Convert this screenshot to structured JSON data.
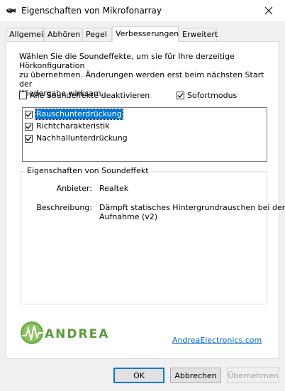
{
  "window": {
    "title": "Eigenschaften von Mikrofonarray",
    "close_label": "×"
  },
  "tabs": [
    {
      "label": "Allgemein"
    },
    {
      "label": "Abhören"
    },
    {
      "label": "Pegel"
    },
    {
      "label": "Verbesserungen",
      "active": true
    },
    {
      "label": "Erweitert"
    }
  ],
  "intro": {
    "line1": "Wählen Sie die Soundeffekte, um sie für Ihre derzeitige Hörkonfiguration",
    "line2": "zu übernehmen. Änderungen werden erst beim nächsten Start der",
    "line3": "Wiedergabe wirksam."
  },
  "options": {
    "disable_all": {
      "label": "Alle Soundeffekte deaktivieren",
      "checked": false
    },
    "immediate": {
      "label": "Sofortmodus",
      "checked": true
    }
  },
  "effects": [
    {
      "label": "Rauschunterdrückung",
      "checked": true,
      "selected": true
    },
    {
      "label": "Richtcharakteristik",
      "checked": true,
      "selected": false
    },
    {
      "label": "Nachhallunterdrückung",
      "checked": true,
      "selected": false
    }
  ],
  "properties": {
    "group_title": "Eigenschaften von Soundeffekt",
    "provider_label": "Anbieter:",
    "provider_value": "Realtek",
    "description_label": "Beschreibung:",
    "description_line1": "Dämpft statisches Hintergrundrauschen bei der",
    "description_line2": "Aufnahme (v2)"
  },
  "vendor": {
    "logo_text": "ANDREA",
    "link_text": "AndreaElectronics.com"
  },
  "buttons": {
    "ok": "OK",
    "cancel": "Abbrechen",
    "apply": "Übernehmen"
  },
  "colors": {
    "accent": "#0078d7",
    "link": "#0066cc",
    "logo_green": "#5a9a3a"
  }
}
